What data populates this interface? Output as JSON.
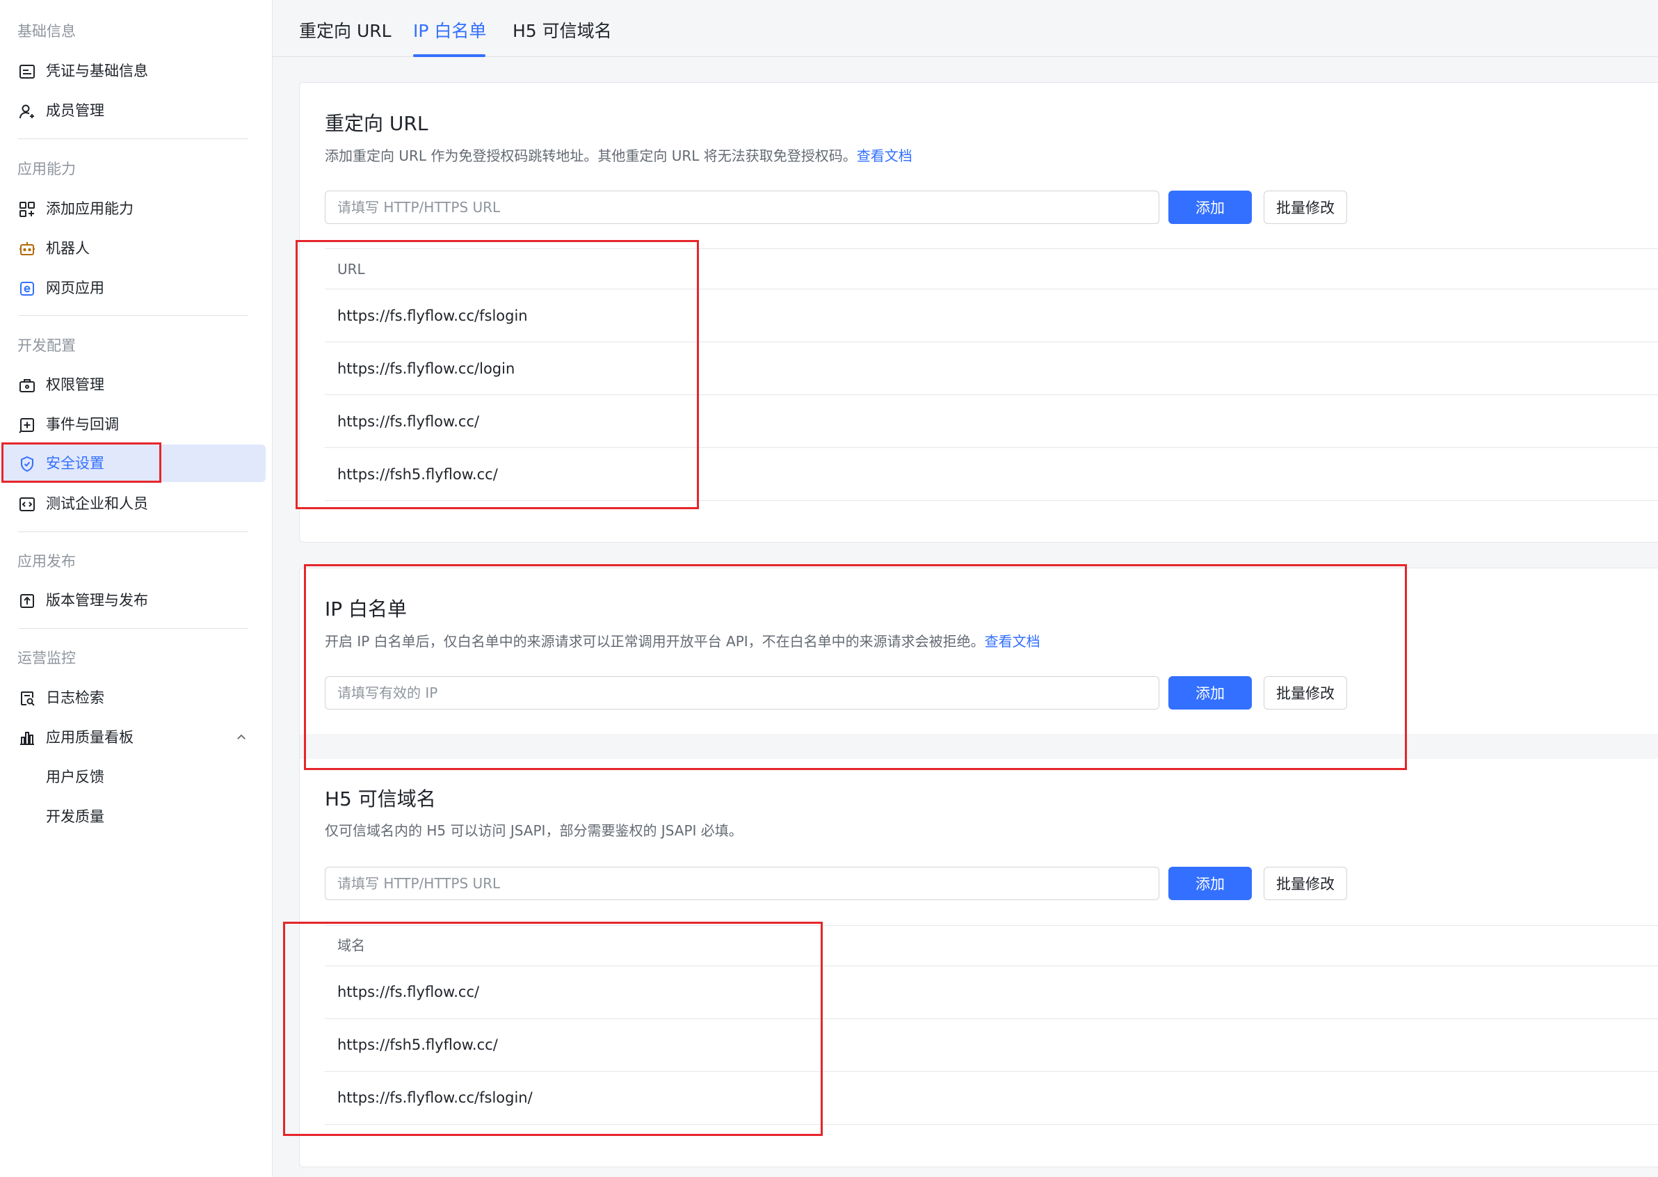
{
  "sidebar": {
    "groups": [
      {
        "title": "基础信息",
        "items": [
          {
            "label": "凭证与基础信息",
            "icon": "credential-icon"
          },
          {
            "label": "成员管理",
            "icon": "member-icon"
          }
        ]
      },
      {
        "title": "应用能力",
        "items": [
          {
            "label": "添加应用能力",
            "icon": "add-capability-icon"
          },
          {
            "label": "机器人",
            "icon": "robot-icon"
          },
          {
            "label": "网页应用",
            "icon": "web-app-icon"
          }
        ]
      },
      {
        "title": "开发配置",
        "items": [
          {
            "label": "权限管理",
            "icon": "permission-icon"
          },
          {
            "label": "事件与回调",
            "icon": "event-icon"
          },
          {
            "label": "安全设置",
            "icon": "shield-icon",
            "active": true
          },
          {
            "label": "测试企业和人员",
            "icon": "test-icon"
          }
        ]
      },
      {
        "title": "应用发布",
        "items": [
          {
            "label": "版本管理与发布",
            "icon": "publish-icon"
          }
        ]
      },
      {
        "title": "运营监控",
        "items": [
          {
            "label": "日志检索",
            "icon": "log-search-icon"
          },
          {
            "label": "应用质量看板",
            "icon": "chart-icon",
            "expanded": true
          },
          {
            "label": "用户反馈"
          },
          {
            "label": "开发质量"
          }
        ]
      }
    ]
  },
  "tabs": [
    {
      "label": "重定向 URL"
    },
    {
      "label": "IP 白名单",
      "active": true
    },
    {
      "label": "H5 可信域名"
    }
  ],
  "redirect": {
    "title": "重定向 URL",
    "desc": "添加重定向 URL 作为免登授权码跳转地址。其他重定向 URL 将无法获取免登授权码。",
    "link": "查看文档",
    "placeholder": "请填写 HTTP/HTTPS URL",
    "add_label": "添加",
    "batch_label": "批量修改",
    "column": "URL",
    "rows": [
      "https://fs.flyflow.cc/fslogin",
      "https://fs.flyflow.cc/login",
      "https://fs.flyflow.cc/",
      "https://fsh5.flyflow.cc/"
    ]
  },
  "ip": {
    "title": "IP 白名单",
    "desc": "开启 IP 白名单后，仅白名单中的来源请求可以正常调用开放平台 API，不在白名单中的来源请求会被拒绝。",
    "link": "查看文档",
    "placeholder": "请填写有效的 IP",
    "add_label": "添加",
    "batch_label": "批量修改"
  },
  "h5": {
    "title": "H5 可信域名",
    "desc": "仅可信域名内的 H5 可以访问 JSAPI，部分需要鉴权的 JSAPI 必填。",
    "placeholder": "请填写 HTTP/HTTPS URL",
    "add_label": "添加",
    "batch_label": "批量修改",
    "column": "域名",
    "rows": [
      "https://fs.flyflow.cc/",
      "https://fsh5.flyflow.cc/",
      "https://fs.flyflow.cc/fslogin/"
    ]
  },
  "colors": {
    "accent": "#3370ff",
    "annotation": "#e5262a",
    "active_bg": "#e1e8fc"
  }
}
